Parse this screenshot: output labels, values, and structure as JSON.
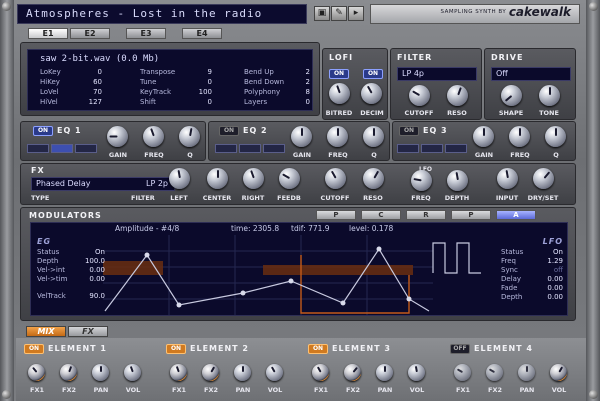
{
  "app": {
    "title": "Atmospheres - Lost in the radio",
    "brand_small": "SAMPLING SYNTH BY",
    "brand_name": "cakewalk"
  },
  "title_buttons": [
    "▣",
    "✎",
    "▸"
  ],
  "element_tabs": [
    {
      "label": "E1",
      "active": true
    },
    {
      "label": "E2",
      "active": false
    },
    {
      "label": "E3",
      "active": false
    },
    {
      "label": "E4",
      "active": false
    }
  ],
  "sample": {
    "filename": "saw 2-bit.wav (0.0 Mb)",
    "col1": [
      {
        "k": "LoKey",
        "v": "0"
      },
      {
        "k": "HiKey",
        "v": "60"
      },
      {
        "k": "LoVel",
        "v": "70"
      },
      {
        "k": "HiVel",
        "v": "127"
      }
    ],
    "col2": [
      {
        "k": "Transpose",
        "v": "9"
      },
      {
        "k": "Tune",
        "v": "0"
      },
      {
        "k": "KeyTrack",
        "v": "100"
      },
      {
        "k": "Shift",
        "v": "0"
      }
    ],
    "col3": [
      {
        "k": "Bend Up",
        "v": "2"
      },
      {
        "k": "Bend Down",
        "v": "2"
      },
      {
        "k": "Polyphony",
        "v": "8"
      },
      {
        "k": "Layers",
        "v": "0"
      }
    ]
  },
  "lofi": {
    "header": "LOFI",
    "on1": "ON",
    "on2": "ON",
    "knob1": "BITRED",
    "knob2": "DECIM"
  },
  "filter": {
    "header": "FILTER",
    "type": "LP 4p",
    "knob1": "CUTOFF",
    "knob2": "RESO"
  },
  "drive": {
    "header": "DRIVE",
    "value": "Off",
    "knob1": "SHAPE",
    "knob2": "TONE"
  },
  "eq": [
    {
      "on": "ON",
      "header": "EQ 1",
      "knobs": [
        "GAIN",
        "FREQ",
        "Q"
      ]
    },
    {
      "on": "ON",
      "header": "EQ 2",
      "knobs": [
        "GAIN",
        "FREQ",
        "Q"
      ]
    },
    {
      "on": "ON",
      "header": "EQ 3",
      "knobs": [
        "GAIN",
        "FREQ",
        "Q"
      ]
    }
  ],
  "fx": {
    "header": "FX",
    "type": "Phased Delay",
    "filter": "LP 2p",
    "type_label": "TYPE",
    "filter_label": "FILTER",
    "knobs": [
      "LEFT",
      "CENTER",
      "RIGHT",
      "FEEDB"
    ],
    "knobs2": [
      "CUTOFF",
      "RESO"
    ],
    "lfo_header": "LFO",
    "lfo_knobs": [
      "FREQ",
      "DEPTH"
    ],
    "io_knobs": [
      "INPUT",
      "DRY/SET"
    ]
  },
  "modulators": {
    "header": "MODULATORS",
    "tabs": [
      {
        "label": "P",
        "active": false
      },
      {
        "label": "C",
        "active": false
      },
      {
        "label": "R",
        "active": false
      },
      {
        "label": "P",
        "active": false
      },
      {
        "label": "A",
        "active": true
      }
    ],
    "amplitude": "Amplitude - #4/8",
    "time": "time: 2305.8",
    "tdif": "tdif: 771.9",
    "level": "level: 0.178",
    "eg_header": "EG",
    "eg": [
      {
        "k": "Status",
        "v": "On"
      },
      {
        "k": "Depth",
        "v": "100.0"
      },
      {
        "k": "Vel->int",
        "v": "0.00"
      },
      {
        "k": "Vel->tim",
        "v": "0.00"
      },
      {
        "k": "VelTrack",
        "v": "90.0"
      }
    ],
    "lfo_header": "LFO",
    "lfo": [
      {
        "k": "Freq",
        "v": "1.29"
      },
      {
        "k": "Sync",
        "v": "off"
      },
      {
        "k": "Delay",
        "v": "0.00"
      },
      {
        "k": "Fade",
        "v": "0.00"
      },
      {
        "k": "Depth",
        "v": "0.00"
      }
    ],
    "lfo_status": {
      "k": "Status",
      "v": "On"
    }
  },
  "bottom": {
    "tab_mix": "MIX",
    "tab_fx": "FX",
    "elements": [
      {
        "on": "ON",
        "label": "ELEMENT 1",
        "on_state": true,
        "knobs": [
          "FX1",
          "FX2",
          "PAN",
          "VOL"
        ]
      },
      {
        "on": "ON",
        "label": "ELEMENT 2",
        "on_state": true,
        "knobs": [
          "FX1",
          "FX2",
          "PAN",
          "VOL"
        ]
      },
      {
        "on": "ON",
        "label": "ELEMENT 3",
        "on_state": true,
        "knobs": [
          "FX1",
          "FX2",
          "PAN",
          "VOL"
        ]
      },
      {
        "on": "OFF",
        "label": "ELEMENT 4",
        "on_state": false,
        "knobs": [
          "FX1",
          "FX2",
          "PAN",
          "VOL"
        ]
      }
    ]
  },
  "colors": {
    "screen_bg": "#0b0a2b",
    "accent_blue": "#3d4fb0",
    "accent_orange": "#d07a20",
    "envelope_bar": "#a84a10"
  }
}
